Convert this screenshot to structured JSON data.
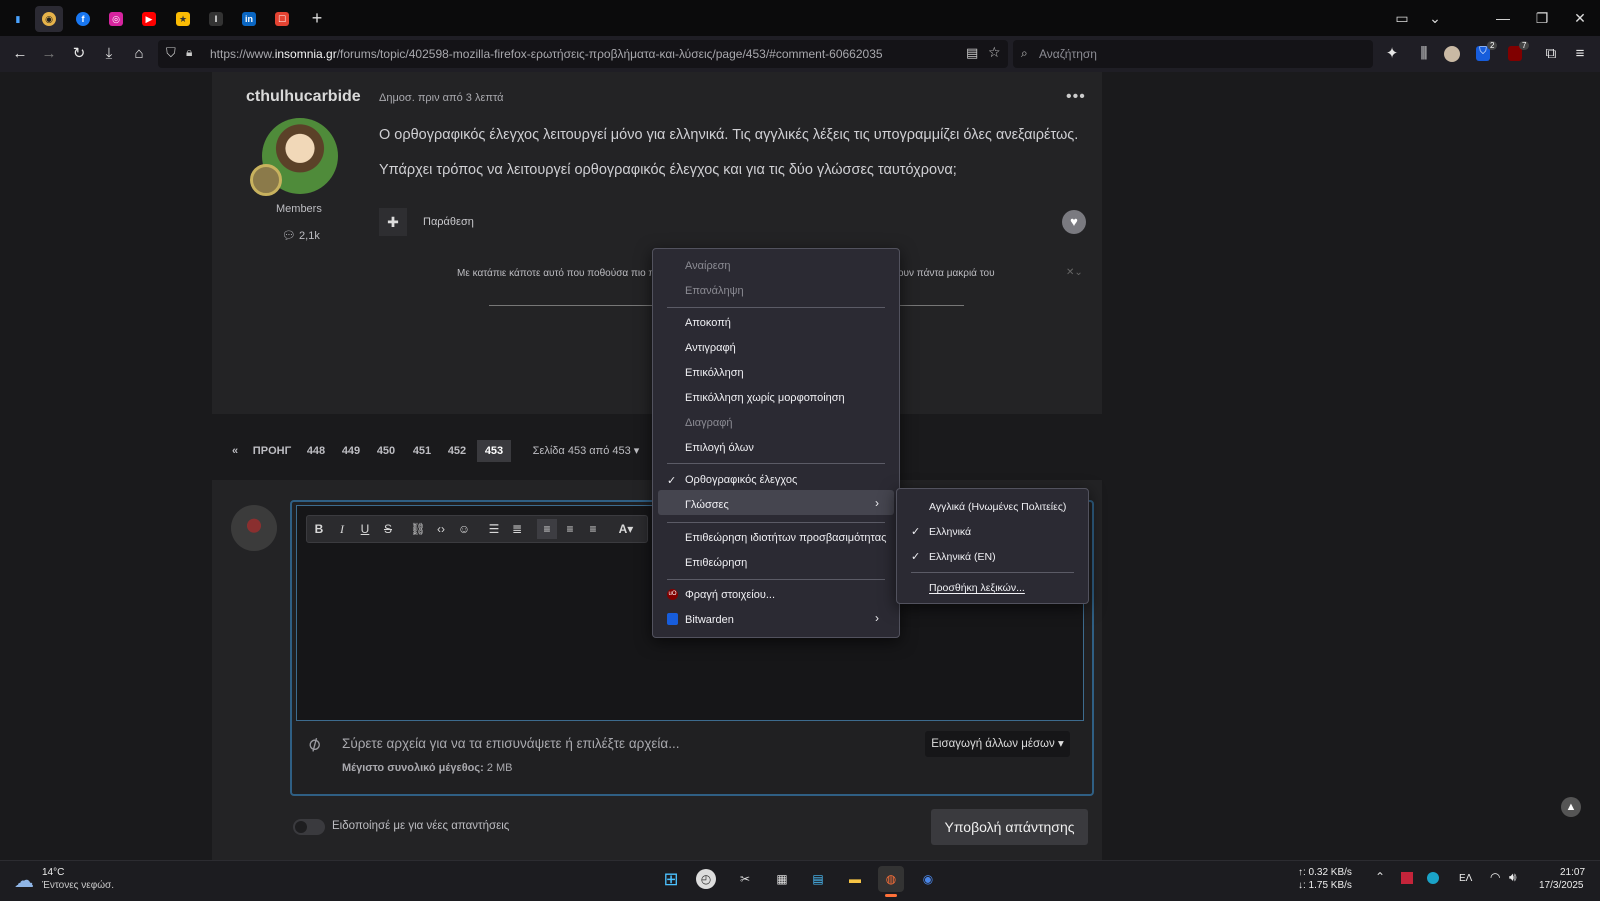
{
  "browser": {
    "url_prefix": "https://www.",
    "url_domain": "insomnia.gr",
    "url_path": "/forums/topic/402598-mozilla-firefox-ερωτήσεις-προβλήματα-και-λύσεις/page/453/#comment-60662035",
    "search_placeholder": "Αναζήτηση",
    "badge_bitwarden": "2",
    "badge_ublock": "7",
    "tabs": [
      "signal-icon",
      "insomnia-icon",
      "facebook-icon",
      "instagram-icon",
      "youtube-icon",
      "keep-icon",
      "imdb-icon",
      "linkedin-icon",
      "todoist-icon"
    ]
  },
  "post": {
    "author": "cthulhucarbide",
    "meta": "Δημοσ. πριν από 3 λεπτά",
    "role": "Members",
    "post_count": "2,1k",
    "line1": "Ο ορθογραφικός έλεγχος λειτουργεί μόνο για ελληνικά. Τις αγγλικές λέξεις τις υπογραμμίζει όλες ανεξαιρέτως.",
    "line2": "Υπάρχει τρόπος να λειτουργεί ορθογραφικός έλεγχος και για τις δύο γλώσσες ταυτόχρονα;",
    "quote_label": "Παράθεση",
    "signature_left": "Με κατάπιε κάποτε αυτό που ποθούσα πιο π",
    "signature_right": "ουν πάντα μακριά του"
  },
  "pagination": {
    "prev": "ΠΡΟΗΓ",
    "pages": [
      "448",
      "449",
      "450",
      "451",
      "452",
      "453"
    ],
    "current": "453",
    "page_of": "Σελίδα 453 από 453"
  },
  "reply": {
    "drop_text": "Σύρετε αρχεία για να τα επισυνάψετε ή επιλέξτε αρχεία...",
    "max_size_label": "Μέγιστο συνολικό μέγεθος:",
    "max_size_value": "2 MB",
    "insert_media": "Εισαγωγή άλλων μέσων",
    "notify": "Ειδοποίησέ με για νέες απαντήσεις",
    "submit": "Υποβολή απάντησης"
  },
  "context_menu": {
    "undo": "Αναίρεση",
    "redo": "Επανάληψη",
    "cut": "Αποκοπή",
    "copy": "Αντιγραφή",
    "paste": "Επικόλληση",
    "paste_plain": "Επικόλληση χωρίς μορφοποίηση",
    "delete": "Διαγραφή",
    "select_all": "Επιλογή όλων",
    "spellcheck": "Ορθογραφικός έλεγχος",
    "languages": "Γλώσσες",
    "inspect_a11y": "Επιθεώρηση ιδιοτήτων προσβασιμότητας",
    "inspect": "Επιθεώρηση",
    "block_element": "Φραγή στοιχείου...",
    "bitwarden": "Bitwarden"
  },
  "languages_menu": {
    "en_us": "Αγγλικά (Ηνωμένες Πολιτείες)",
    "el": "Ελληνικά",
    "el_en": "Ελληνικά (EN)",
    "add_dict": "Προσθήκη λεξικών..."
  },
  "taskbar": {
    "temp": "14°C",
    "weather": "Έντονες νεφώσ.",
    "upload": "↑: 0.32 KB/s",
    "download": "↓: 1.75 KB/s",
    "lang": "ΕΛ",
    "time": "21:07",
    "date": "17/3/2025"
  },
  "colors": {
    "accent": "#2f5f84",
    "menu_bg": "#2b2a33"
  }
}
